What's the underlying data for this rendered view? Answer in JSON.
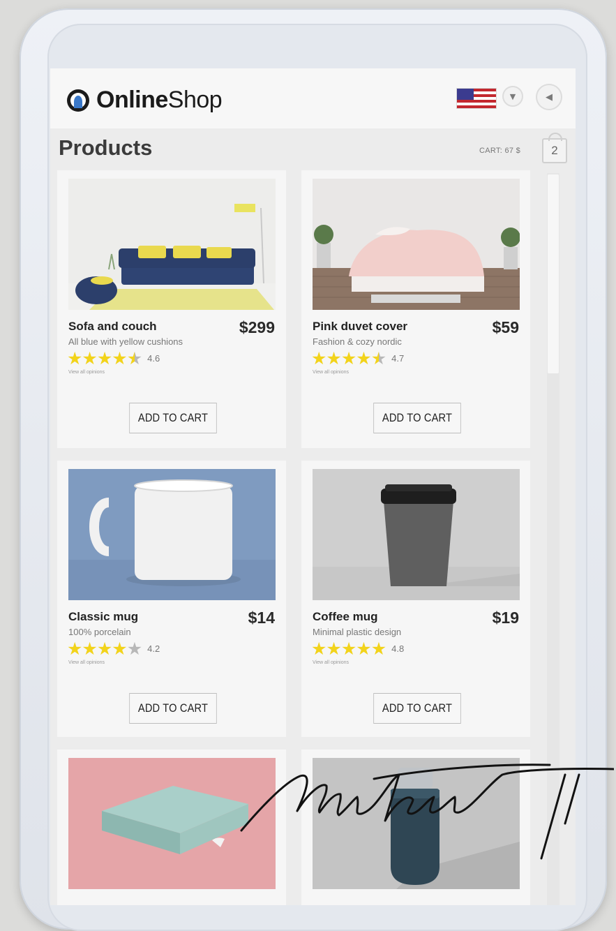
{
  "brand": {
    "bold": "Online",
    "regular": "Shop"
  },
  "header": {
    "title": "Products",
    "cart_label": "CART: 67 $",
    "cart_count": "2"
  },
  "icons": {
    "logo": "logo-icon",
    "flag": "us-flag-icon",
    "dropdown": "chevron-down-icon",
    "back": "back-arrow-icon",
    "cart": "cart-bag-icon"
  },
  "products": [
    {
      "name": "Sofa and couch",
      "price": "$299",
      "desc": "All blue with yellow cushions",
      "rating": "4.6",
      "rating_value": 4.6,
      "opinions": "View all opinions",
      "button": "ADD TO CART"
    },
    {
      "name": "Pink duvet cover",
      "price": "$59",
      "desc": "Fashion & cozy nordic",
      "rating": "4.7",
      "rating_value": 4.7,
      "opinions": "View all opinions",
      "button": "ADD TO CART"
    },
    {
      "name": "Classic mug",
      "price": "$14",
      "desc": "100% porcelain",
      "rating": "4.2",
      "rating_value": 4.2,
      "opinions": "View all opinions",
      "button": "ADD TO CART"
    },
    {
      "name": "Coffee mug",
      "price": "$19",
      "desc": "Minimal plastic design",
      "rating": "4.8",
      "rating_value": 4.8,
      "opinions": "View all opinions",
      "button": "ADD TO CART"
    }
  ],
  "colors": {
    "star": "#f2d31b",
    "star_empty": "#b8b8b8"
  }
}
